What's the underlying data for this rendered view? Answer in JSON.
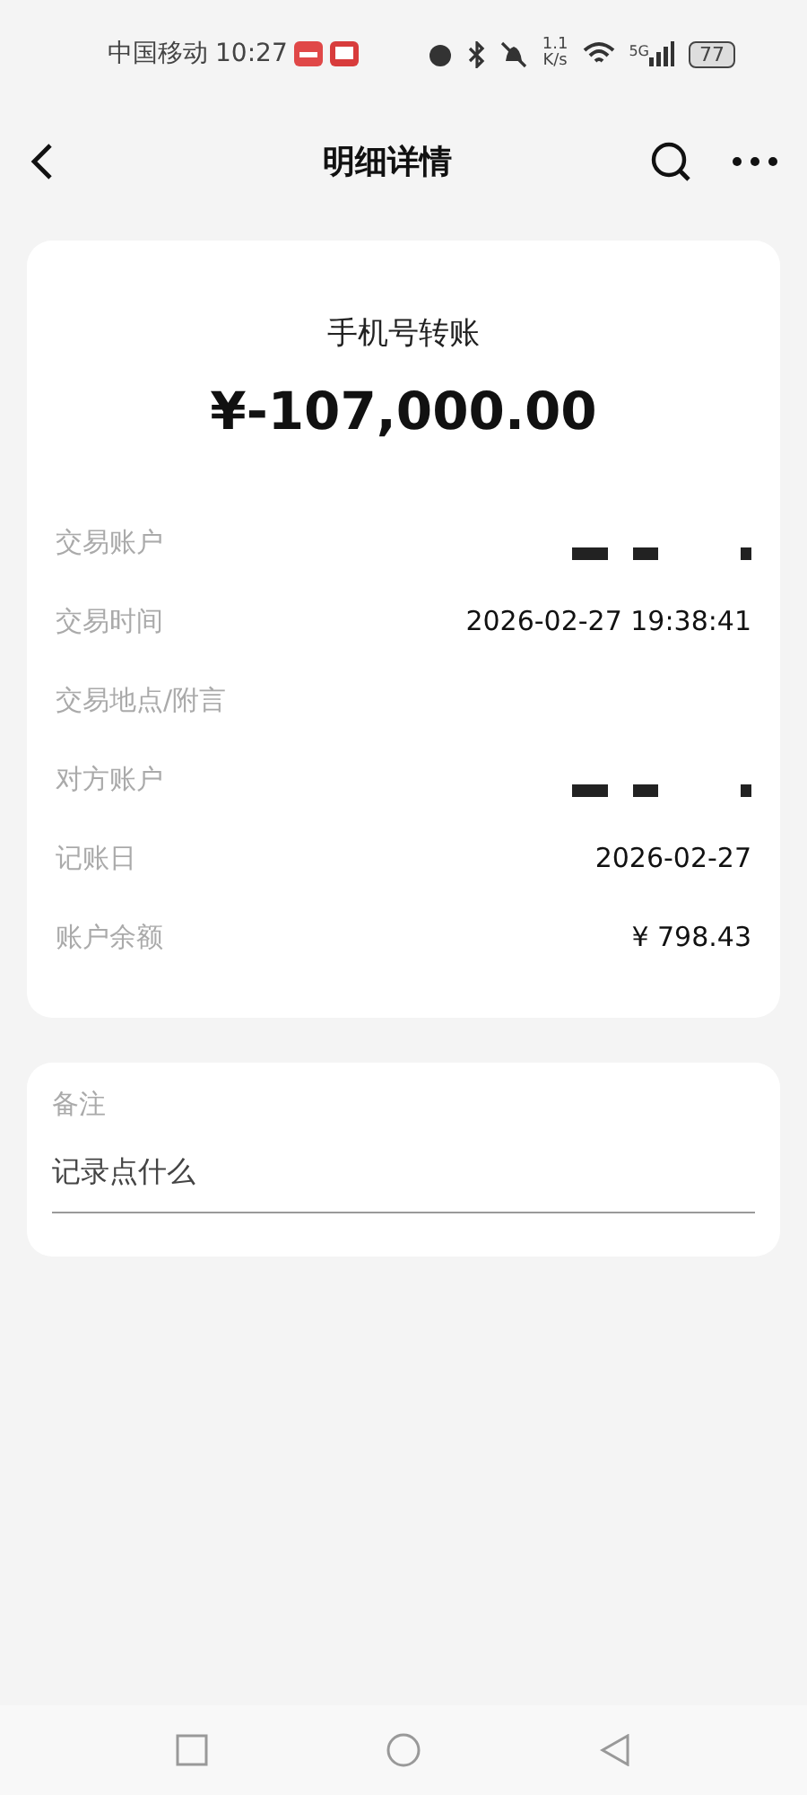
{
  "status_bar": {
    "carrier": "中国移动",
    "time": "10:27",
    "speed": [
      "1.1",
      "K/s"
    ],
    "network": "5G",
    "battery": "77"
  },
  "header": {
    "title": "明细详情"
  },
  "summary": {
    "type": "手机号转账",
    "amount": "¥-107,000.00"
  },
  "details": [
    {
      "label": "交易账户",
      "kind": "redacted"
    },
    {
      "label": "交易时间",
      "kind": "text",
      "value": "2026-02-27 19:38:41"
    },
    {
      "label": "交易地点/附言",
      "kind": "empty"
    },
    {
      "label": "对方账户",
      "kind": "redacted"
    },
    {
      "label": "记账日",
      "kind": "text",
      "value": "2026-02-27"
    },
    {
      "label": "账户余额",
      "kind": "text",
      "value": "¥ 798.43"
    }
  ],
  "note": {
    "label": "备注",
    "placeholder": "记录点什么"
  }
}
